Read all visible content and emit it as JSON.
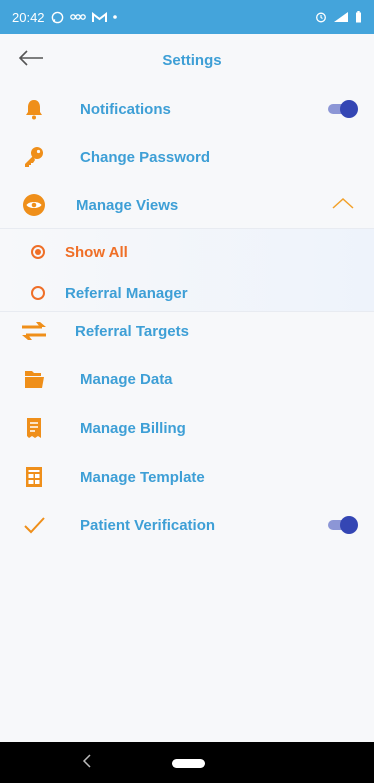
{
  "status_bar": {
    "time": "20:42"
  },
  "header": {
    "title": "Settings"
  },
  "menu": {
    "notifications": "Notifications",
    "change_password": "Change Password",
    "manage_views": "Manage Views",
    "referral_targets": "Referral Targets",
    "manage_data": "Manage Data",
    "manage_billing": "Manage Billing",
    "manage_template": "Manage Template",
    "patient_verification": "Patient Verification"
  },
  "views_options": {
    "show_all": "Show All",
    "referral_manager": "Referral Manager"
  },
  "toggles": {
    "notifications_on": true,
    "patient_verification_on": true
  },
  "colors": {
    "accent": "#3e9fd6",
    "orange": "#ef8f1a",
    "selected": "#ef6f27",
    "toggle": "#3446b4",
    "status_bar": "#44a4db"
  },
  "icons": [
    "bell-icon",
    "key-icon",
    "eye-icon",
    "swap-arrows-icon",
    "folder-icon",
    "receipt-icon",
    "template-grid-icon",
    "check-icon",
    "back-arrow-icon",
    "chevron-up-icon"
  ]
}
